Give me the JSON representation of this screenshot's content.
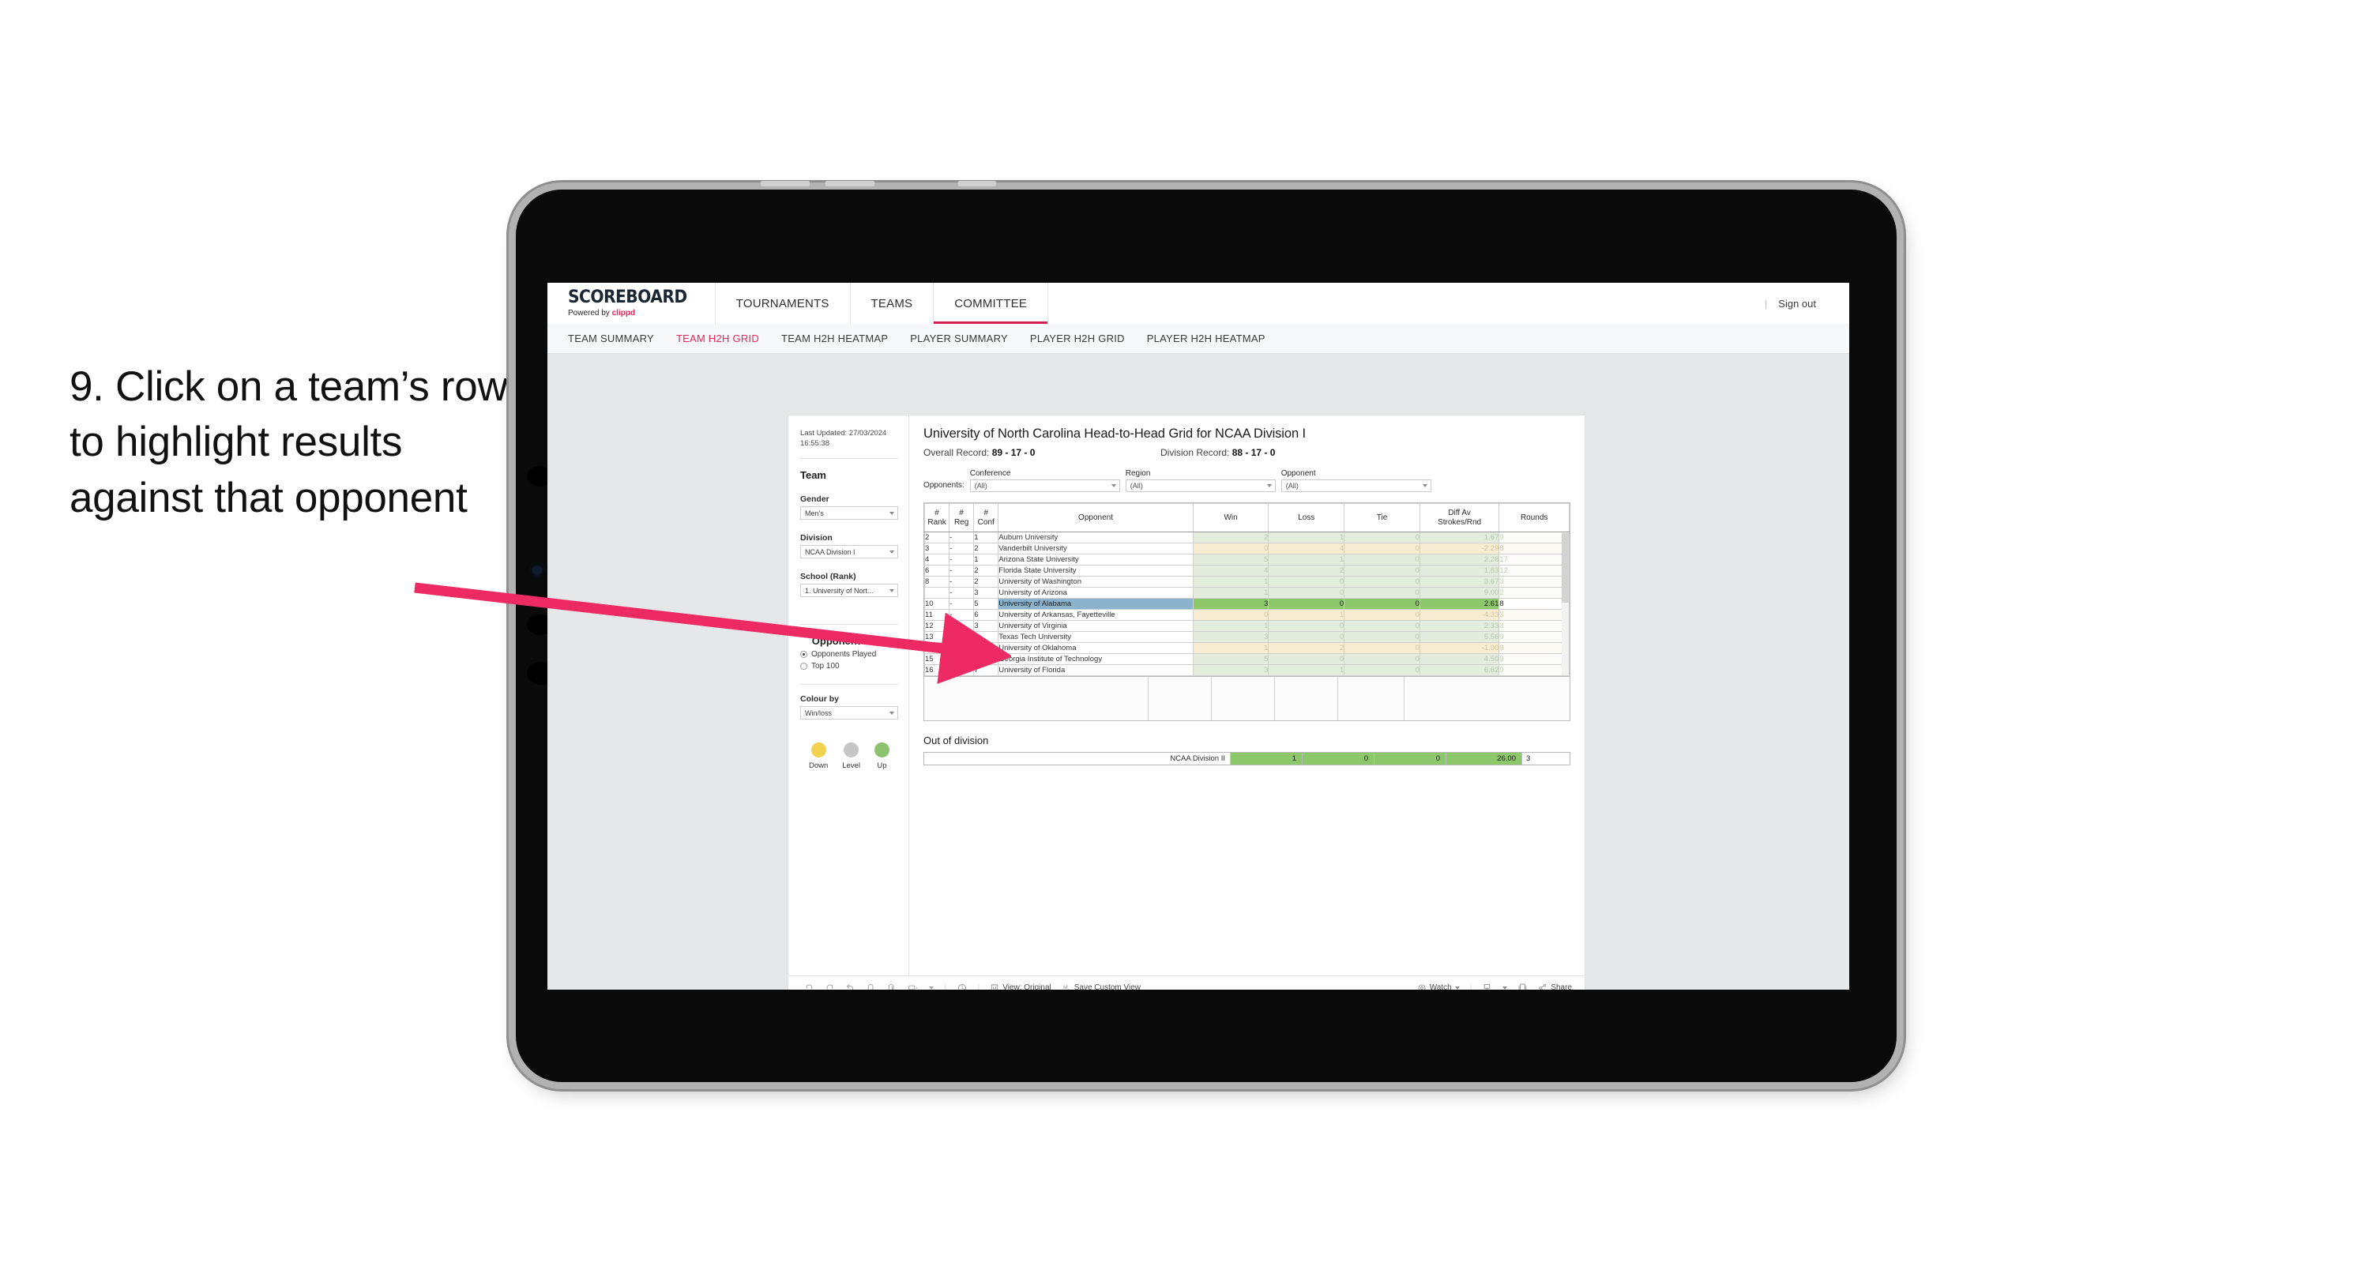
{
  "annotation": {
    "text": "9. Click on a team’s row to highlight results against that opponent",
    "arrow_color": "#ED2A64"
  },
  "topbar": {
    "brand_word": "SCOREBOARD",
    "brand_powered_prefix": "Powered by ",
    "brand_powered_name": "clippd",
    "nav": [
      {
        "label": "TOURNAMENTS",
        "active": false
      },
      {
        "label": "TEAMS",
        "active": false
      },
      {
        "label": "COMMITTEE",
        "active": true
      }
    ],
    "divider": "|",
    "sign_out": "Sign out"
  },
  "subnav": [
    {
      "label": "TEAM SUMMARY",
      "active": false
    },
    {
      "label": "TEAM H2H GRID",
      "active": true
    },
    {
      "label": "TEAM H2H HEATMAP",
      "active": false
    },
    {
      "label": "PLAYER SUMMARY",
      "active": false
    },
    {
      "label": "PLAYER H2H GRID",
      "active": false
    },
    {
      "label": "PLAYER H2H HEATMAP",
      "active": false
    }
  ],
  "filter_panel": {
    "last_updated_line1": "Last Updated: 27/03/2024",
    "last_updated_line2": "16:55:38",
    "team_heading": "Team",
    "gender_label": "Gender",
    "gender_value": "Men’s",
    "division_label": "Division",
    "division_value": "NCAA Division I",
    "school_label": "School (Rank)",
    "school_value": "1. University of Nort...",
    "opponent_view_heading": "Opponent View",
    "opponent_view_options": [
      {
        "label": "Opponents Played",
        "selected": true
      },
      {
        "label": "Top 100",
        "selected": false
      }
    ],
    "colour_by_label": "Colour by",
    "colour_by_value": "Win/loss",
    "legend": [
      {
        "label": "Down",
        "color": "#F2D14E"
      },
      {
        "label": "Level",
        "color": "#C6C6C6"
      },
      {
        "label": "Up",
        "color": "#8DC26F"
      }
    ]
  },
  "viz": {
    "title": "University of North Carolina Head-to-Head Grid for NCAA Division I",
    "overall_record_label": "Overall Record: ",
    "overall_record_value": "89 - 17 - 0",
    "division_record_label": "Division Record: ",
    "division_record_value": "88 - 17 - 0",
    "opponents_label": "Opponents:",
    "filters": [
      {
        "header": "Conference",
        "value": "(All)"
      },
      {
        "header": "Region",
        "value": "(All)"
      },
      {
        "header": "Opponent",
        "value": "(All)"
      }
    ],
    "columns": [
      "# Rank",
      "# Reg",
      "# Conf",
      "Opponent",
      "Win",
      "Loss",
      "Tie",
      "Diff Av Strokes/Rnd",
      "Rounds"
    ],
    "column_labels": {
      "rank_l1": "#",
      "rank_l2": "Rank",
      "reg_l1": "#",
      "reg_l2": "Reg",
      "conf_l1": "#",
      "conf_l2": "Conf",
      "opponent": "Opponent",
      "win": "Win",
      "loss": "Loss",
      "tie": "Tie",
      "diff_l1": "Diff Av",
      "diff_l2": "Strokes/Rnd",
      "rounds": "Rounds"
    },
    "rows": [
      {
        "rank": "2",
        "reg": "-",
        "conf": "1",
        "opponent": "Auburn University",
        "win": "2",
        "loss": "1",
        "tie": "0",
        "diff": "1.67",
        "rounds": "9",
        "state": "win"
      },
      {
        "rank": "3",
        "reg": "-",
        "conf": "2",
        "opponent": "Vanderbilt University",
        "win": "0",
        "loss": "4",
        "tie": "0",
        "diff": "-2.29",
        "rounds": "8",
        "state": "loss"
      },
      {
        "rank": "4",
        "reg": "-",
        "conf": "1",
        "opponent": "Arizona State University",
        "win": "5",
        "loss": "1",
        "tie": "0",
        "diff": "2.28",
        "rounds": "17",
        "state": "win"
      },
      {
        "rank": "6",
        "reg": "-",
        "conf": "2",
        "opponent": "Florida State University",
        "win": "4",
        "loss": "2",
        "tie": "0",
        "diff": "1.83",
        "rounds": "12",
        "state": "win"
      },
      {
        "rank": "8",
        "reg": "-",
        "conf": "2",
        "opponent": "University of Washington",
        "win": "1",
        "loss": "0",
        "tie": "0",
        "diff": "3.67",
        "rounds": "3",
        "state": "win"
      },
      {
        "rank": "",
        "reg": "-",
        "conf": "3",
        "opponent": "University of Arizona",
        "win": "1",
        "loss": "0",
        "tie": "0",
        "diff": "9.00",
        "rounds": "2",
        "state": "win"
      },
      {
        "rank": "10",
        "reg": "-",
        "conf": "5",
        "opponent": "University of Alabama",
        "win": "3",
        "loss": "0",
        "tie": "0",
        "diff": "2.61",
        "rounds": "8",
        "state": "selected"
      },
      {
        "rank": "11",
        "reg": "-",
        "conf": "6",
        "opponent": "University of Arkansas, Fayetteville",
        "win": "0",
        "loss": "1",
        "tie": "0",
        "diff": "-4.33",
        "rounds": "3",
        "state": "loss"
      },
      {
        "rank": "12",
        "reg": "-",
        "conf": "3",
        "opponent": "University of Virginia",
        "win": "1",
        "loss": "0",
        "tie": "0",
        "diff": "2.33",
        "rounds": "3",
        "state": "win"
      },
      {
        "rank": "13",
        "reg": "-",
        "conf": "1",
        "opponent": "Texas Tech University",
        "win": "3",
        "loss": "0",
        "tie": "0",
        "diff": "5.56",
        "rounds": "9",
        "state": "win"
      },
      {
        "rank": "14",
        "reg": "-",
        "conf": "2",
        "opponent": "University of Oklahoma",
        "win": "1",
        "loss": "2",
        "tie": "0",
        "diff": "-1.00",
        "rounds": "9",
        "state": "loss"
      },
      {
        "rank": "15",
        "reg": "-",
        "conf": "4",
        "opponent": "Georgia Institute of Technology",
        "win": "5",
        "loss": "0",
        "tie": "0",
        "diff": "4.50",
        "rounds": "9",
        "state": "win"
      },
      {
        "rank": "16",
        "reg": "-",
        "conf": "7",
        "opponent": "University of Florida",
        "win": "3",
        "loss": "1",
        "tie": "0",
        "diff": "6.62",
        "rounds": "9",
        "state": "win"
      }
    ],
    "out_of_division": {
      "heading": "Out of division",
      "label": "NCAA Division II",
      "win": "1",
      "loss": "0",
      "tie": "0",
      "diff": "26.00",
      "rounds": "3"
    }
  },
  "toolbar": {
    "view_original": "View: Original",
    "save_custom_view": "Save Custom View",
    "watch": "Watch",
    "share": "Share",
    "separator": "|"
  },
  "chart_data": {
    "type": "table",
    "title": "University of North Carolina Head-to-Head Grid for NCAA Division I",
    "columns": [
      "# Rank",
      "# Reg",
      "# Conf",
      "Opponent",
      "Win",
      "Loss",
      "Tie",
      "Diff Av Strokes/Rnd",
      "Rounds"
    ],
    "rows": [
      [
        "2",
        "-",
        "1",
        "Auburn University",
        2,
        1,
        0,
        1.67,
        9
      ],
      [
        "3",
        "-",
        "2",
        "Vanderbilt University",
        0,
        4,
        0,
        -2.29,
        8
      ],
      [
        "4",
        "-",
        "1",
        "Arizona State University",
        5,
        1,
        0,
        2.28,
        17
      ],
      [
        "6",
        "-",
        "2",
        "Florida State University",
        4,
        2,
        0,
        1.83,
        12
      ],
      [
        "8",
        "-",
        "2",
        "University of Washington",
        1,
        0,
        0,
        3.67,
        3
      ],
      [
        "",
        "-",
        "3",
        "University of Arizona",
        1,
        0,
        0,
        9.0,
        2
      ],
      [
        "10",
        "-",
        "5",
        "University of Alabama",
        3,
        0,
        0,
        2.61,
        8
      ],
      [
        "11",
        "-",
        "6",
        "University of Arkansas, Fayetteville",
        0,
        1,
        0,
        -4.33,
        3
      ],
      [
        "12",
        "-",
        "3",
        "University of Virginia",
        1,
        0,
        0,
        2.33,
        3
      ],
      [
        "13",
        "-",
        "1",
        "Texas Tech University",
        3,
        0,
        0,
        5.56,
        9
      ],
      [
        "14",
        "-",
        "2",
        "University of Oklahoma",
        1,
        2,
        0,
        -1.0,
        9
      ],
      [
        "15",
        "-",
        "4",
        "Georgia Institute of Technology",
        5,
        0,
        0,
        4.5,
        9
      ],
      [
        "16",
        "-",
        "7",
        "University of Florida",
        3,
        1,
        0,
        6.62,
        9
      ]
    ],
    "out_of_division_row": [
      "NCAA Division II",
      1,
      0,
      0,
      26.0,
      3
    ],
    "selected_row": "University of Alabama",
    "colour_encoding": {
      "win": "#e3ecdd",
      "loss": "#f7ecd2",
      "selected_win": "#8cc76a",
      "selected_label": "#8cb3cd"
    },
    "summary": {
      "overall_record": "89 - 17 - 0",
      "division_record": "88 - 17 - 0"
    }
  }
}
